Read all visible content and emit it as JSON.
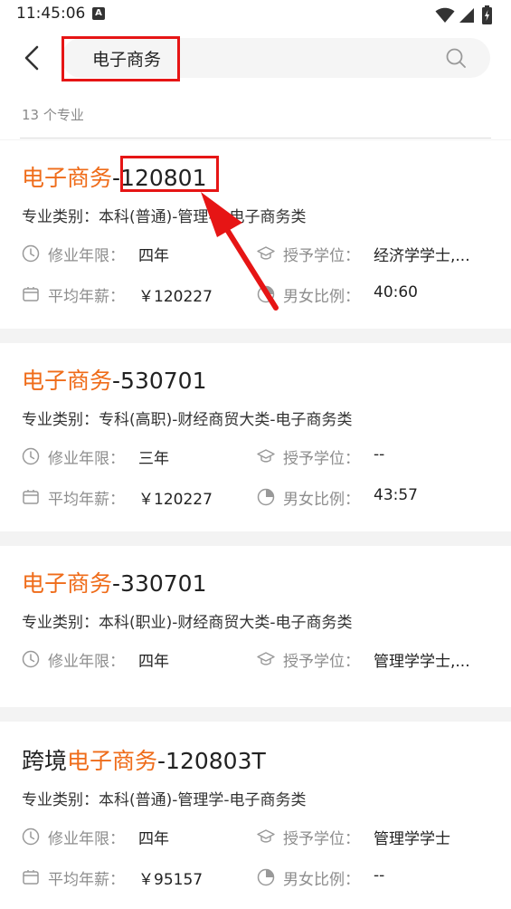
{
  "status_bar": {
    "time": "11:45:06",
    "a_icon": "A"
  },
  "search": {
    "query": "电子商务",
    "result_count": "13 个专业"
  },
  "labels": {
    "category": "专业类别：",
    "duration": "修业年限：",
    "degree": "授予学位：",
    "salary": "平均年薪：",
    "gender": "男女比例："
  },
  "majors": [
    {
      "title_prefix": "",
      "title_highlight": "电子商务",
      "title_suffix": "-120801",
      "category": "本科(普通)-管理学-电子商务类",
      "duration": "四年",
      "degree": "经济学学士,...",
      "salary": "￥120227",
      "gender_ratio": "40:60"
    },
    {
      "title_prefix": "",
      "title_highlight": "电子商务",
      "title_suffix": "-530701",
      "category": "专科(高职)-财经商贸大类-电子商务类",
      "duration": "三年",
      "degree": "--",
      "salary": "￥120227",
      "gender_ratio": "43:57"
    },
    {
      "title_prefix": "",
      "title_highlight": "电子商务",
      "title_suffix": "-330701",
      "category": "本科(职业)-财经商贸大类-电子商务类",
      "duration": "四年",
      "degree": "管理学学士,..."
    },
    {
      "title_prefix": "跨境",
      "title_highlight": "电子商务",
      "title_suffix": "-120803T",
      "category": "本科(普通)-管理学-电子商务类",
      "duration": "四年",
      "degree": "管理学学士",
      "salary": "￥95157",
      "gender_ratio": "--"
    }
  ],
  "colors": {
    "highlight": "#ef6c1a",
    "annotation": "#e61515"
  }
}
